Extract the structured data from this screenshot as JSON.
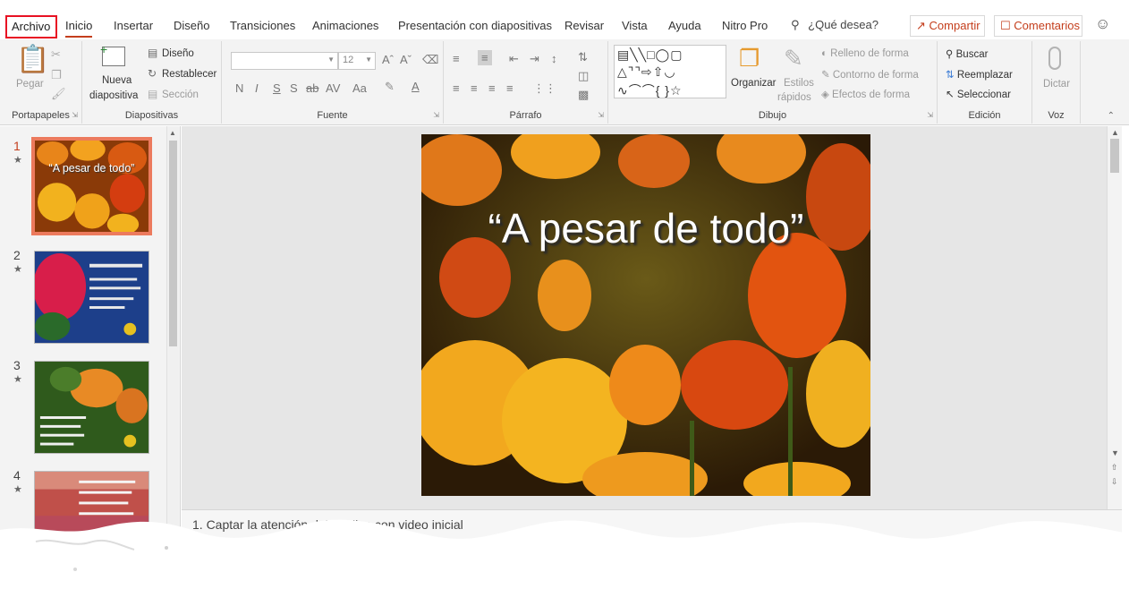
{
  "tabs": {
    "file": "Archivo",
    "items": [
      "Inicio",
      "Insertar",
      "Diseño",
      "Transiciones",
      "Animaciones",
      "Presentación con diapositivas",
      "Revisar",
      "Vista",
      "Ayuda",
      "Nitro Pro"
    ],
    "search": "¿Qué desea?",
    "share": "Compartir",
    "comments": "Comentarios"
  },
  "ribbon": {
    "clipboard": {
      "label": "Portapapeles",
      "paste": "Pegar"
    },
    "slides": {
      "label": "Diapositivas",
      "new_slide_1": "Nueva",
      "new_slide_2": "diapositiva",
      "layout": "Diseño",
      "reset": "Restablecer",
      "section": "Sección"
    },
    "font": {
      "label": "Fuente",
      "size": "12",
      "bold": "N",
      "italic": "I",
      "underline": "S",
      "shadow": "S",
      "strike": "ab",
      "spacing": "AV",
      "case": "Aa",
      "color_a": "A"
    },
    "paragraph": {
      "label": "Párrafo"
    },
    "drawing": {
      "label": "Dibujo",
      "arrange": "Organizar",
      "quick_styles_1": "Estilos",
      "quick_styles_2": "rápidos",
      "fill": "Relleno de forma",
      "outline": "Contorno de forma",
      "effects": "Efectos de forma"
    },
    "editing": {
      "label": "Edición",
      "find": "Buscar",
      "replace": "Reemplazar",
      "select": "Seleccionar"
    },
    "voice": {
      "label": "Voz",
      "dictate": "Dictar"
    }
  },
  "thumbnails": [
    {
      "num": "1",
      "title": "“A pesar de todo”",
      "selected": true
    },
    {
      "num": "2",
      "title": "",
      "selected": false
    },
    {
      "num": "3",
      "title": "",
      "selected": false
    },
    {
      "num": "4",
      "title": "",
      "selected": false
    }
  ],
  "slide": {
    "title": "“A pesar de todo”"
  },
  "notes": {
    "text": "1.  Captar la atención del público con video inicial"
  },
  "colors": {
    "accent": "#c43e1c",
    "highlight_box": "#e81123",
    "thumb_selected": "#ec7a5d"
  }
}
